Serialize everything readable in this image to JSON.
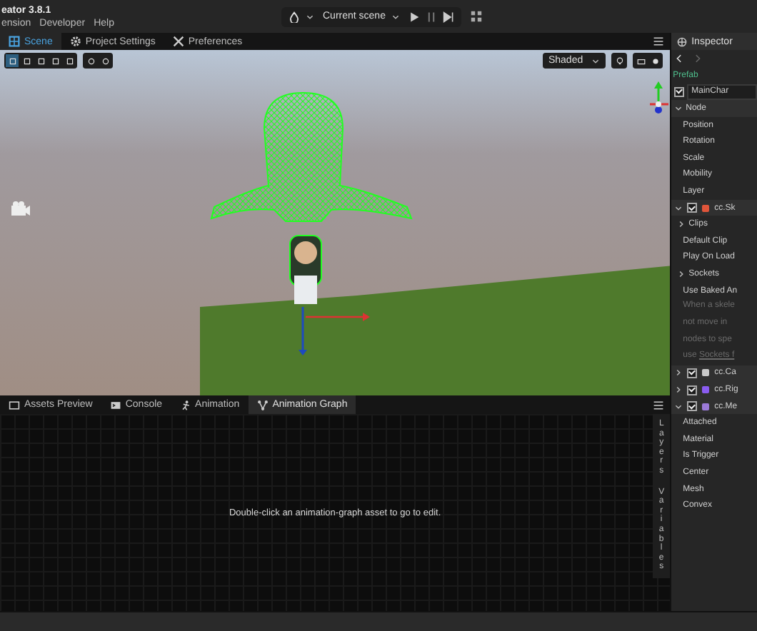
{
  "title_bar": {
    "title": "eator 3.8.1",
    "menus": [
      "ension",
      "Developer",
      "Help"
    ]
  },
  "toolbar": {
    "scene_select": "Current scene"
  },
  "main_tabs": [
    {
      "label": "Scene",
      "selected": true
    },
    {
      "label": "Project Settings",
      "selected": false
    },
    {
      "label": "Preferences",
      "selected": false
    }
  ],
  "scene": {
    "shading": "Shaded"
  },
  "bottom_tabs": [
    {
      "label": "Assets Preview",
      "selected": false
    },
    {
      "label": "Console",
      "selected": false
    },
    {
      "label": "Animation",
      "selected": false
    },
    {
      "label": "Animation Graph",
      "selected": true
    }
  ],
  "graph": {
    "message": "Double-click an animation-graph asset to go to edit.",
    "side_tabs": [
      "Layers",
      "Variables"
    ]
  },
  "inspector": {
    "tab": "Inspector",
    "items": [
      {
        "kind": "header",
        "label": "Prefab"
      },
      {
        "kind": "node",
        "label": "MainChar",
        "checked": true
      },
      {
        "kind": "section",
        "label": "Node",
        "expanded": true
      },
      {
        "kind": "prop",
        "label": "Position"
      },
      {
        "kind": "prop",
        "label": "Rotation"
      },
      {
        "kind": "prop",
        "label": "Scale"
      },
      {
        "kind": "prop",
        "label": "Mobility"
      },
      {
        "kind": "prop",
        "label": "Layer"
      },
      {
        "kind": "component",
        "label": "cc.Sk",
        "checked": true,
        "expanded": true,
        "color": "#e0553a"
      },
      {
        "kind": "group",
        "label": "Clips",
        "expanded": false
      },
      {
        "kind": "prop",
        "label": "Default Clip"
      },
      {
        "kind": "prop",
        "label": "Play On Load"
      },
      {
        "kind": "group",
        "label": "Sockets",
        "expanded": false
      },
      {
        "kind": "prop",
        "label": "Use Baked An"
      },
      {
        "kind": "warning",
        "lines": [
          "When a skele",
          "not move in",
          "nodes to spe"
        ],
        "prefix": "use ",
        "link": "Sockets f"
      },
      {
        "kind": "component",
        "label": "cc.Ca",
        "checked": true,
        "expanded": false,
        "color": "#c8c8c8"
      },
      {
        "kind": "component",
        "label": "cc.Rig",
        "checked": true,
        "expanded": false,
        "color": "#8a5cf0"
      },
      {
        "kind": "component",
        "label": "cc.Me",
        "checked": true,
        "expanded": true,
        "color": "#9b7ad8"
      },
      {
        "kind": "prop",
        "label": "Attached"
      },
      {
        "kind": "prop",
        "label": "Material"
      },
      {
        "kind": "prop",
        "label": "Is Trigger"
      },
      {
        "kind": "prop",
        "label": "Center"
      },
      {
        "kind": "prop",
        "label": "Mesh"
      },
      {
        "kind": "prop",
        "label": "Convex"
      }
    ]
  }
}
